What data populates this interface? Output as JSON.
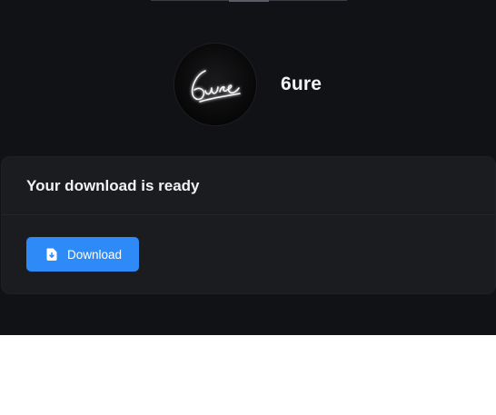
{
  "profile": {
    "name": "6ure",
    "avatar_icon": "neon-signature-logo",
    "avatar_signature": "6ure"
  },
  "card": {
    "title": "Your download is ready",
    "download_button_label": "Download",
    "download_button_icon": "file-download-icon"
  },
  "colors": {
    "app_background": "#111215",
    "card_background": "#1b1c20",
    "accent": "#2d8af7",
    "page_background": "#ffffff"
  }
}
